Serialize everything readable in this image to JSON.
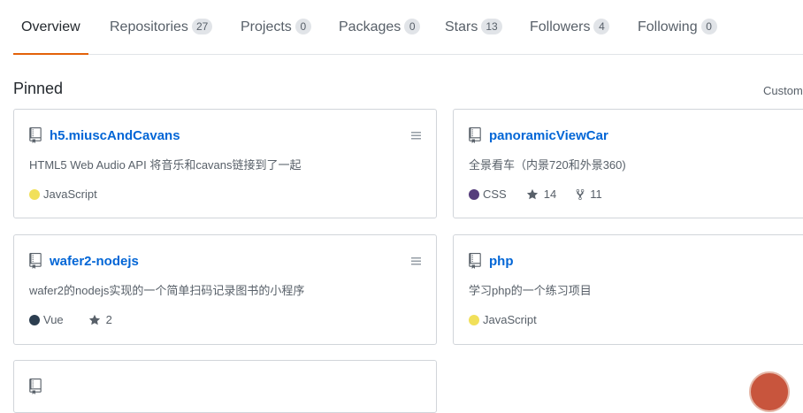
{
  "tabs": [
    {
      "label": "Overview",
      "count": null,
      "selected": true
    },
    {
      "label": "Repositories",
      "count": "27"
    },
    {
      "label": "Projects",
      "count": "0"
    },
    {
      "label": "Packages",
      "count": "0"
    },
    {
      "label": "Stars",
      "count": "13"
    },
    {
      "label": "Followers",
      "count": "4"
    },
    {
      "label": "Following",
      "count": "0"
    }
  ],
  "pinned": {
    "title": "Pinned",
    "customize_label": "Custom",
    "repos": [
      {
        "name": "h5.miuscAndCavans",
        "description": "HTML5 Web Audio API 将音乐和cavans链接到了一起",
        "language": "JavaScript",
        "language_color": "#f1e05a",
        "stars": null,
        "forks": null
      },
      {
        "name": "panoramicViewCar",
        "description": "全景看车（内景720和外景360)",
        "language": "CSS",
        "language_color": "#563d7c",
        "stars": "14",
        "forks": "11"
      },
      {
        "name": "wafer2-nodejs",
        "description": "wafer2的nodejs实现的一个简单扫码记录图书的小程序",
        "language": "Vue",
        "language_color": "#2c3e50",
        "stars": "2",
        "forks": null
      },
      {
        "name": "php",
        "description": "学习php的一个练习项目",
        "language": "JavaScript",
        "language_color": "#f1e05a",
        "stars": null,
        "forks": null
      }
    ]
  },
  "colors": {
    "accent": "#e36209",
    "link": "#0366d6"
  },
  "icons": {
    "repo": "repo-icon",
    "grip": "grabber-icon",
    "star": "star-icon",
    "fork": "fork-icon"
  }
}
